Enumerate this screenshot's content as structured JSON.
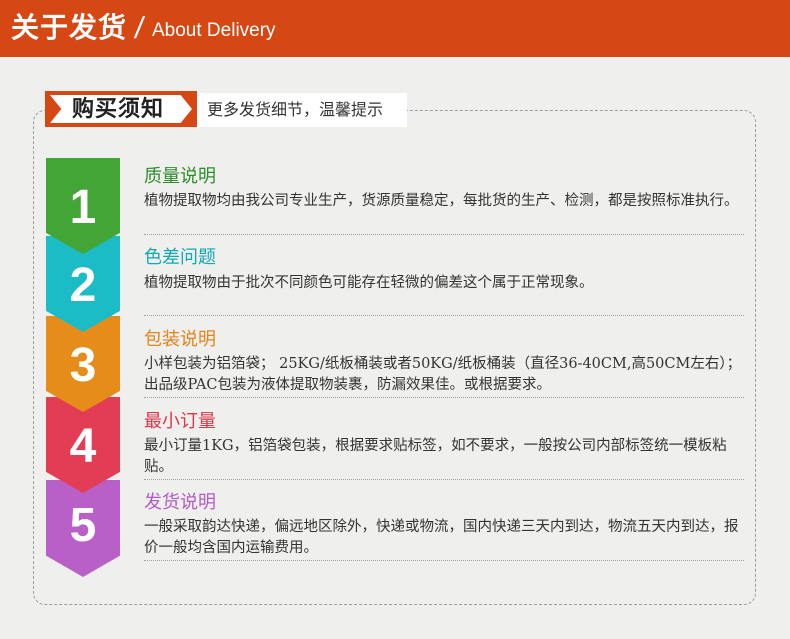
{
  "header": {
    "title_cn": "关于发货",
    "slash": "/",
    "title_en": "About Delivery"
  },
  "notice": {
    "title": "购买须知",
    "subtitle": "更多发货细节，温馨提示"
  },
  "items": [
    {
      "number": "1",
      "title": "质量说明",
      "desc": "植物提取物均由我公司专业生产，货源质量稳定，每批货的生产、检测，都是按照标准执行。",
      "color": "#43a536",
      "title_color": "#2e8d2b"
    },
    {
      "number": "2",
      "title": "色差问题",
      "desc": "植物提取物由于批次不同颜色可能存在轻微的偏差这个属于正常现象。",
      "color": "#1cbcc6",
      "title_color": "#12a9b5"
    },
    {
      "number": "3",
      "title": "包装说明",
      "desc": "小样包装为铝箔袋； 25KG/纸板桶装或者50KG/纸板桶装（直径36-40CM,高50CM左右）；出品级PAC包装为液体提取物装裹，防漏效果佳。或根据要求。",
      "color": "#e58c1b",
      "title_color": "#e3841a"
    },
    {
      "number": "4",
      "title": "最小订量",
      "desc": "最小订量1KG，铝箔袋包装，根据要求贴标签，如不要求，一般按公司内部标签统一模板粘贴。",
      "color": "#e33c55",
      "title_color": "#de3648"
    },
    {
      "number": "5",
      "title": "发货说明",
      "desc": "一般采取韵达快递，偏远地区除外，快递或物流，国内快递三天内到达，物流五天内到达，报价一般均含国内运输费用。",
      "color": "#b85fc8",
      "title_color": "#b25bc4"
    }
  ]
}
